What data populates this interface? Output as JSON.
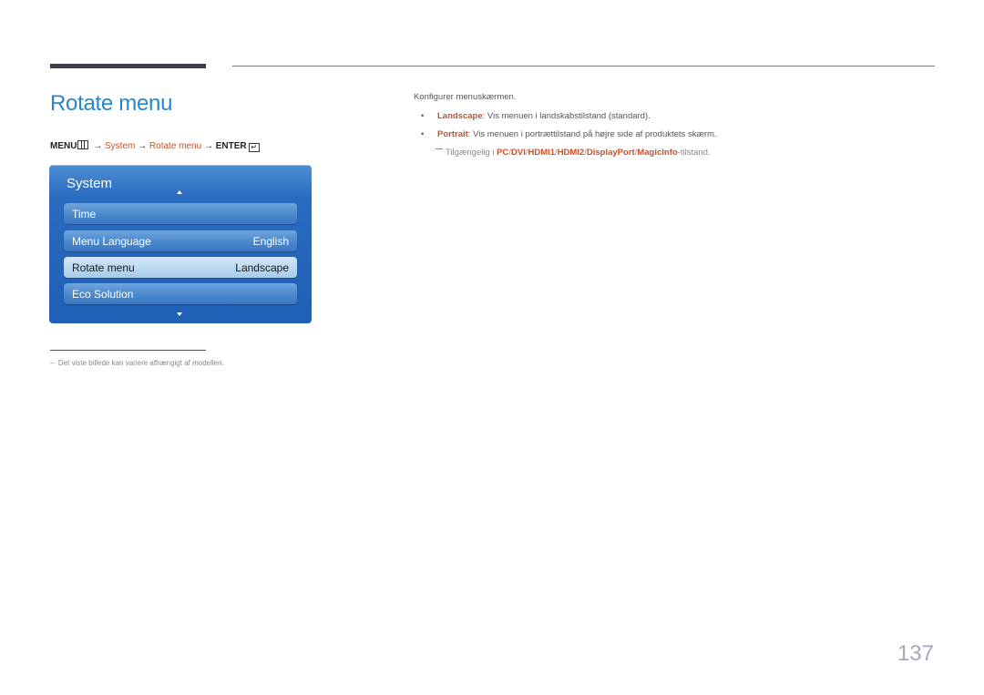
{
  "page": {
    "title": "Rotate menu",
    "page_number": "137"
  },
  "menu_path": {
    "menu": "MENU",
    "arrow": "→",
    "system": "System",
    "rotate": "Rotate menu",
    "enter": "ENTER",
    "menu_icon": "menu-grid-icon",
    "enter_icon": "enter-icon",
    "enter_glyph": "↵"
  },
  "osd": {
    "title": "System",
    "items": [
      {
        "label": "Time",
        "value": ""
      },
      {
        "label": "Menu Language",
        "value": "English"
      },
      {
        "label": "Rotate menu",
        "value": "Landscape",
        "selected": true
      },
      {
        "label": "Eco Solution",
        "value": ""
      }
    ],
    "colors": {
      "panel": "#1f5fb4",
      "item": "#4b88cc",
      "selected": "#b9d6ef"
    }
  },
  "description": {
    "intro": "Konfigurer menuskærmen.",
    "bullets": [
      {
        "term": "Landscape",
        "text": ": Vis menuen i landskabstilstand (standard)."
      },
      {
        "term": "Portrait",
        "text": ": Vis menuen i portrættilstand på højre side af produktets skærm."
      }
    ],
    "note": {
      "prefix": "Tilgængelig i ",
      "sources": [
        "PC",
        "DVI",
        "HDMI1",
        "HDMI2",
        "DisplayPort",
        "MagicInfo"
      ],
      "sep": "/",
      "suffix": "-tilstand."
    }
  },
  "footnote": "Det viste billede kan variere afhængigt af modellen.",
  "footnote_dash": "–",
  "colors": {
    "title": "#2b86c8",
    "highlight": "#c8502a",
    "page_number": "#a6a9bb"
  }
}
